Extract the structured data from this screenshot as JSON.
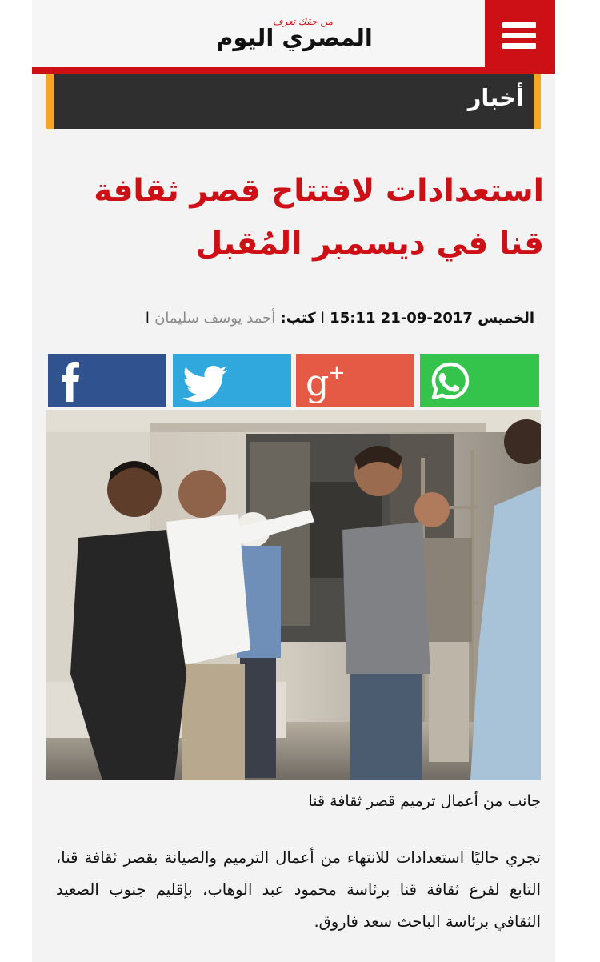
{
  "header": {
    "logo_tagline": "من حقك تعرف",
    "logo_name": "المصري اليوم",
    "menu_icon": "hamburger-icon"
  },
  "section": {
    "label": "أخبار"
  },
  "article": {
    "title": "استعدادات لافتتاح قصر ثقافة قنا في ديسمبر المُقبل",
    "day": "الخميس",
    "date": "2017-09-21",
    "time": "15:11",
    "byline_label": "كتب:",
    "author": "أحمد يوسف سليمان",
    "separator": "ا",
    "image_caption": "جانب من أعمال ترميم قصر ثقافة قنا",
    "body": "تجري حاليًا استعدادات للانتهاء من أعمال الترميم والصيانة بقصر ثقافة قنا، التابع لفرع ثقافة قنا برئاسة محمود عبد الوهاب، بإقليم جنوب الصعيد الثقافي برئاسة الباحث سعد فاروق."
  },
  "share": [
    {
      "icon": "facebook-icon",
      "color": "#30538f"
    },
    {
      "icon": "twitter-icon",
      "color": "#31a8dd"
    },
    {
      "icon": "google-plus-icon",
      "color": "#e45a45"
    },
    {
      "icon": "whatsapp-icon",
      "color": "#35c44b"
    }
  ],
  "colors": {
    "brand_red": "#cc1016",
    "section_bar": "#2f2f2f",
    "section_accent": "#f5a623"
  }
}
